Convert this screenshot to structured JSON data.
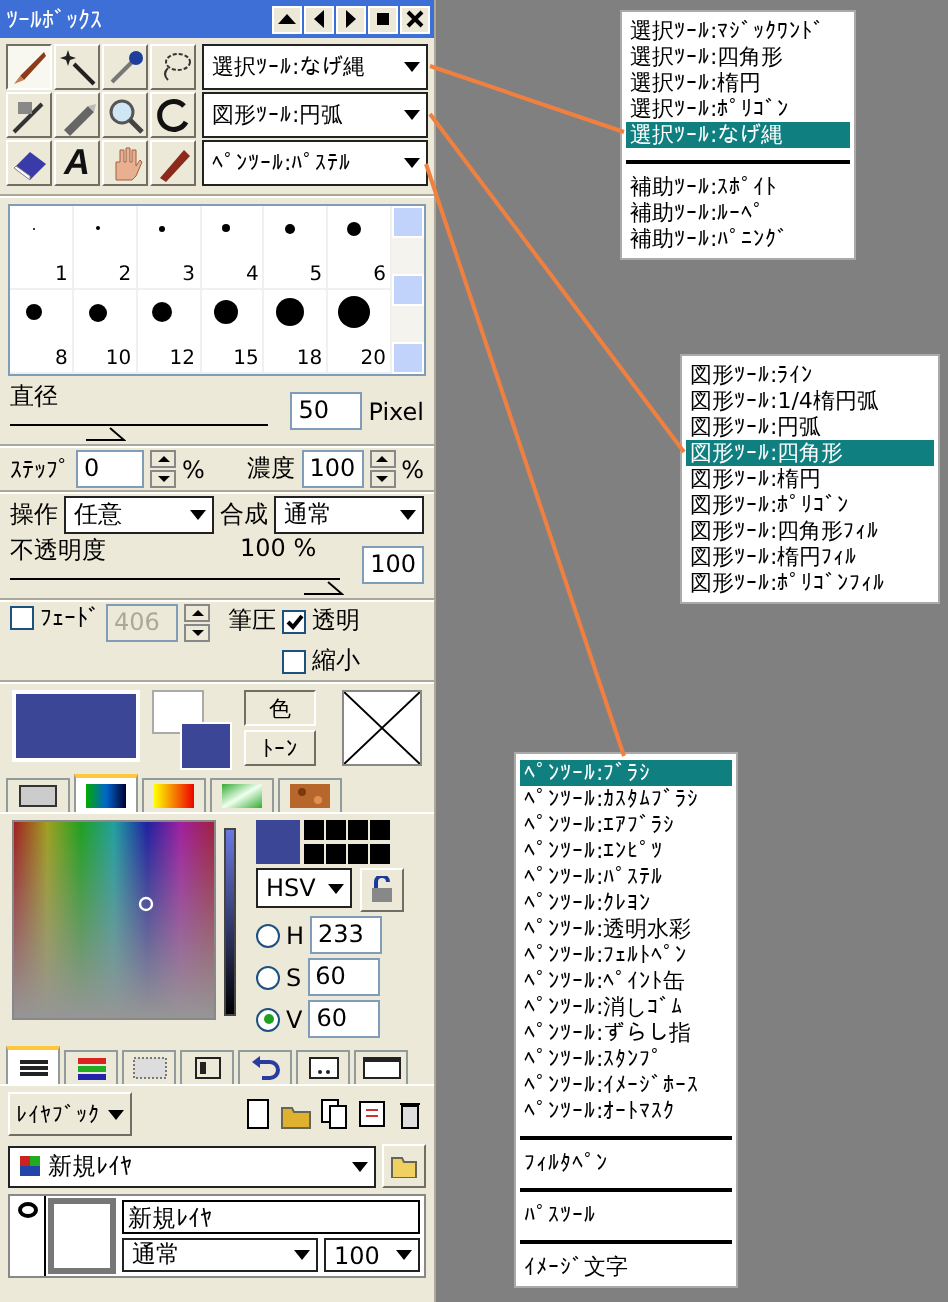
{
  "window": {
    "title": "ﾂｰﾙﾎﾞｯｸｽ"
  },
  "tools": [
    {
      "kind": "brush",
      "selected": true
    },
    {
      "kind": "wand",
      "selected": false
    },
    {
      "kind": "dropper",
      "selected": false
    },
    {
      "kind": "lasso",
      "selected": false
    },
    {
      "kind": "airbrush",
      "selected": false
    },
    {
      "kind": "marker",
      "selected": false
    },
    {
      "kind": "magnifier",
      "selected": false
    },
    {
      "kind": "arc",
      "selected": false
    },
    {
      "kind": "eraser",
      "selected": false
    },
    {
      "kind": "text",
      "glyph": "A",
      "selected": false
    },
    {
      "kind": "hand",
      "selected": false
    },
    {
      "kind": "crayon",
      "selected": false
    }
  ],
  "tool_selects": [
    "選択ﾂｰﾙ:なげ縄",
    "図形ﾂｰﾙ:円弧",
    "ﾍﾟﾝﾂｰﾙ:ﾊﾟｽﾃﾙ"
  ],
  "brush_sizes": [
    "1",
    "2",
    "3",
    "4",
    "5",
    "6",
    "8",
    "10",
    "12",
    "15",
    "18",
    "20"
  ],
  "diameter": {
    "label": "直径",
    "level": 0.37,
    "value": "50",
    "unit": "Pixel"
  },
  "step": {
    "label": "ｽﾃｯﾌﾟ",
    "value": "0",
    "unit": "%"
  },
  "density": {
    "label": "濃度",
    "value": "100",
    "unit": "%"
  },
  "operation": {
    "label": "操作",
    "value": "任意"
  },
  "composite": {
    "label": "合成",
    "value": "通常"
  },
  "opacity": {
    "label": "不透明度",
    "reading": "100 %",
    "level": 1,
    "value": "100"
  },
  "fade": {
    "label": "ﾌｪｰﾄﾞ",
    "checked": false,
    "value": "406",
    "disabled": true
  },
  "pressure": {
    "label": "筆圧",
    "options": [
      {
        "label": "透明",
        "checked": true
      },
      {
        "label": "縮小",
        "checked": false
      }
    ]
  },
  "color_modes": [
    {
      "label": "色",
      "selected": true
    },
    {
      "label": "ﾄｰﾝ",
      "selected": false
    }
  ],
  "color_tabs": [
    {
      "kind": "pattern",
      "selected": false
    },
    {
      "kind": "spectrum",
      "selected": true
    },
    {
      "kind": "warm",
      "selected": false
    },
    {
      "kind": "green",
      "selected": false
    },
    {
      "kind": "texture",
      "selected": false
    }
  ],
  "color_model": "HSV",
  "hsv": [
    {
      "label": "H",
      "value": "233",
      "selected": false
    },
    {
      "label": "S",
      "value": "60",
      "selected": false
    },
    {
      "label": "V",
      "value": "60",
      "selected": true
    }
  ],
  "layer_tabs": [
    {
      "kind": "layers",
      "selected": true
    },
    {
      "kind": "colors",
      "selected": false
    },
    {
      "kind": "selection",
      "selected": false
    },
    {
      "kind": "panel",
      "selected": false
    },
    {
      "kind": "undo",
      "selected": false
    },
    {
      "kind": "cassette",
      "selected": false
    },
    {
      "kind": "window",
      "selected": false
    }
  ],
  "layer_book": "ﾚｲﾔﾌﾞｯｸ",
  "layer_set": "新規ﾚｲﾔ",
  "layers": [
    {
      "name": "新規ﾚｲﾔ",
      "visible": true,
      "blend": "通常",
      "opacity": "100"
    }
  ],
  "menus": [
    {
      "items": [
        {
          "kind": "item",
          "label": "選択ﾂｰﾙ:ﾏｼﾞｯｸﾜﾝﾄﾞ",
          "selected": false
        },
        {
          "kind": "item",
          "label": "選択ﾂｰﾙ:四角形",
          "selected": false
        },
        {
          "kind": "item",
          "label": "選択ﾂｰﾙ:楕円",
          "selected": false
        },
        {
          "kind": "item",
          "label": "選択ﾂｰﾙ:ﾎﾟﾘｺﾞﾝ",
          "selected": false
        },
        {
          "kind": "item",
          "label": "選択ﾂｰﾙ:なげ縄",
          "selected": true
        },
        {
          "kind": "separator"
        },
        {
          "kind": "item",
          "label": "補助ﾂｰﾙ:ｽﾎﾟｲﾄ",
          "selected": false
        },
        {
          "kind": "item",
          "label": "補助ﾂｰﾙ:ﾙｰﾍﾟ",
          "selected": false
        },
        {
          "kind": "item",
          "label": "補助ﾂｰﾙ:ﾊﾟﾆﾝｸﾞ",
          "selected": false
        }
      ]
    },
    {
      "items": [
        {
          "kind": "item",
          "label": "図形ﾂｰﾙ:ﾗｲﾝ",
          "selected": false
        },
        {
          "kind": "item",
          "label": "図形ﾂｰﾙ:1/4楕円弧",
          "selected": false
        },
        {
          "kind": "item",
          "label": "図形ﾂｰﾙ:円弧",
          "selected": false
        },
        {
          "kind": "item",
          "label": "図形ﾂｰﾙ:四角形",
          "selected": true
        },
        {
          "kind": "item",
          "label": "図形ﾂｰﾙ:楕円",
          "selected": false
        },
        {
          "kind": "item",
          "label": "図形ﾂｰﾙ:ﾎﾟﾘｺﾞﾝ",
          "selected": false
        },
        {
          "kind": "item",
          "label": "図形ﾂｰﾙ:四角形ﾌｨﾙ",
          "selected": false
        },
        {
          "kind": "item",
          "label": "図形ﾂｰﾙ:楕円ﾌｨﾙ",
          "selected": false
        },
        {
          "kind": "item",
          "label": "図形ﾂｰﾙ:ﾎﾟﾘｺﾞﾝﾌｨﾙ",
          "selected": false
        }
      ]
    },
    {
      "items": [
        {
          "kind": "item",
          "label": "ﾍﾟﾝﾂｰﾙ:ﾌﾞﾗｼ",
          "selected": true
        },
        {
          "kind": "item",
          "label": "ﾍﾟﾝﾂｰﾙ:ｶｽﾀﾑﾌﾞﾗｼ",
          "selected": false
        },
        {
          "kind": "item",
          "label": "ﾍﾟﾝﾂｰﾙ:ｴｱﾌﾞﾗｼ",
          "selected": false
        },
        {
          "kind": "item",
          "label": "ﾍﾟﾝﾂｰﾙ:ｴﾝﾋﾟﾂ",
          "selected": false
        },
        {
          "kind": "item",
          "label": "ﾍﾟﾝﾂｰﾙ:ﾊﾟｽﾃﾙ",
          "selected": false
        },
        {
          "kind": "item",
          "label": "ﾍﾟﾝﾂｰﾙ:ｸﾚﾖﾝ",
          "selected": false
        },
        {
          "kind": "item",
          "label": "ﾍﾟﾝﾂｰﾙ:透明水彩",
          "selected": false
        },
        {
          "kind": "item",
          "label": "ﾍﾟﾝﾂｰﾙ:ﾌｪﾙﾄﾍﾟﾝ",
          "selected": false
        },
        {
          "kind": "item",
          "label": "ﾍﾟﾝﾂｰﾙ:ﾍﾟｲﾝﾄ缶",
          "selected": false
        },
        {
          "kind": "item",
          "label": "ﾍﾟﾝﾂｰﾙ:消しｺﾞﾑ",
          "selected": false
        },
        {
          "kind": "item",
          "label": "ﾍﾟﾝﾂｰﾙ:ずらし指",
          "selected": false
        },
        {
          "kind": "item",
          "label": "ﾍﾟﾝﾂｰﾙ:ｽﾀﾝﾌﾟ",
          "selected": false
        },
        {
          "kind": "item",
          "label": "ﾍﾟﾝﾂｰﾙ:ｲﾒｰｼﾞﾎｰｽ",
          "selected": false
        },
        {
          "kind": "item",
          "label": "ﾍﾟﾝﾂｰﾙ:ｵｰﾄﾏｽｸ",
          "selected": false
        },
        {
          "kind": "separator"
        },
        {
          "kind": "item",
          "label": "ﾌｨﾙﾀﾍﾟﾝ",
          "selected": false
        },
        {
          "kind": "separator"
        },
        {
          "kind": "item",
          "label": "ﾊﾟｽﾂｰﾙ",
          "selected": false
        },
        {
          "kind": "separator"
        },
        {
          "kind": "item",
          "label": "ｲﾒｰｼﾞ文字",
          "selected": false
        }
      ]
    }
  ]
}
